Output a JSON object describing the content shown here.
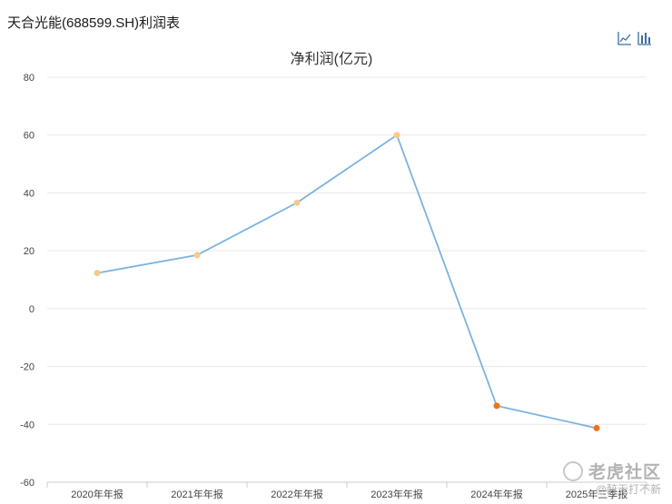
{
  "header": {
    "title": "天合光能(688599.SH)利润表"
  },
  "toolbar": {
    "line_icon": "line-chart-icon",
    "bar_icon": "bar-chart-icon"
  },
  "colors": {
    "line": "#7ab3e0",
    "point_positive": "#f9c98a",
    "point_negative": "#f07116",
    "grid": "#e8e8e8",
    "axis": "#cccccc"
  },
  "chart_data": {
    "type": "line",
    "title": "净利润(亿元)",
    "xlabel": "",
    "ylabel": "",
    "categories": [
      "2020年年报",
      "2021年年报",
      "2022年年报",
      "2023年年报",
      "2024年年报",
      "2025年三季报"
    ],
    "series": [
      {
        "values": [
          12.3,
          18.5,
          36.6,
          60.0,
          -33.6,
          -41.3
        ]
      }
    ],
    "ylim": [
      -60,
      80
    ],
    "yticks": [
      80,
      60,
      40,
      20,
      0,
      -20,
      -40,
      -60
    ],
    "grid": true,
    "legend": "none"
  },
  "watermark": {
    "brand": "老虎社区",
    "user": "@醉无打不新"
  }
}
